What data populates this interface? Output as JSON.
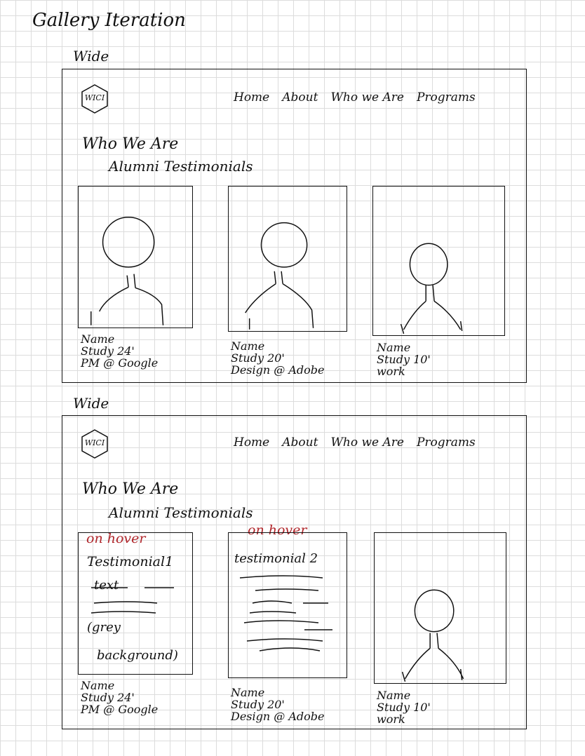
{
  "page_title": "Gallery Iteration",
  "sketches": [
    {
      "label": "Wide",
      "logo_text": "WICI",
      "nav": [
        "Home",
        "About",
        "Who we Are",
        "Programs"
      ],
      "heading": "Who We Are",
      "subheading": "Alumni Testimonials",
      "cards": [
        {
          "name": "Name",
          "study": "Study 24'",
          "work": "PM @ Google"
        },
        {
          "name": "Name",
          "study": "Study 20'",
          "work": "Design @ Adobe"
        },
        {
          "name": "Name",
          "study": "Study 10'",
          "work": "work"
        }
      ]
    },
    {
      "label": "Wide",
      "logo_text": "WICI",
      "nav": [
        "Home",
        "About",
        "Who we Are",
        "Programs"
      ],
      "heading": "Who We Are",
      "subheading": "Alumni Testimonials",
      "hover_cards": [
        {
          "hover_note": "on hover",
          "title": "Testimonial1",
          "line1": "text",
          "line2": "(grey",
          "line3": "background)"
        },
        {
          "hover_note": "on hover",
          "title": "testimonial 2"
        }
      ],
      "cards": [
        {
          "name": "Name",
          "study": "Study 24'",
          "work": "PM @ Google"
        },
        {
          "name": "Name",
          "study": "Study 20'",
          "work": "Design @ Adobe"
        },
        {
          "name": "Name",
          "study": "Study 10'",
          "work": "work"
        }
      ]
    }
  ],
  "colors": {
    "ink": "#111111",
    "red_ink": "#b0262b",
    "grid": "#dcdcdc"
  }
}
